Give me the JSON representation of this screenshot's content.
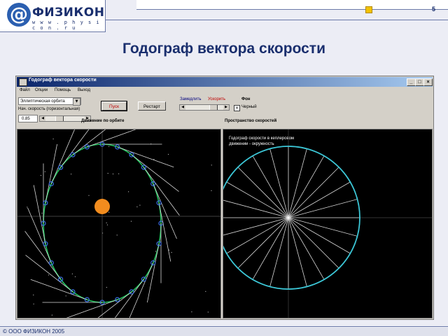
{
  "slide": {
    "logo_name": "ФИЗИКОН",
    "logo_url": "w w w . p h y s i c o n . r u",
    "logo_at": "@",
    "page_number": "5",
    "title": "Годограф вектора скорости",
    "footer": "© ООО ФИЗИКОН 2005"
  },
  "window": {
    "title": "Годограф вектора скорости",
    "buttons": {
      "minimize": "_",
      "maximize": "□",
      "close": "×"
    },
    "menu": [
      "Файл",
      "Опции",
      "Помощь",
      "Выход"
    ],
    "orbit_select": "Эллиптическая орбита",
    "speed_label": "Нач. скорость (горизонтальная)",
    "speed_value": "0.85",
    "start_button": "Пуск",
    "restart_button": "Рестарт",
    "slow_label": "Замедлить",
    "fast_label": "Ускорить",
    "bg_label": "Фон",
    "bg_option": "Черный",
    "bg_checked": "×",
    "left_caption": "Движение по орбите",
    "right_caption": "Пространство скоростей",
    "right_note_1": "Годограф скорости в кеплеровом",
    "right_note_2": "движении - окружность",
    "colors": {
      "orbit": "#22c55e",
      "sun": "#f28c1e",
      "hodograph": "#3cc8d8",
      "markers": "#3b6fe0",
      "vectors": "#d8d8d8"
    }
  }
}
